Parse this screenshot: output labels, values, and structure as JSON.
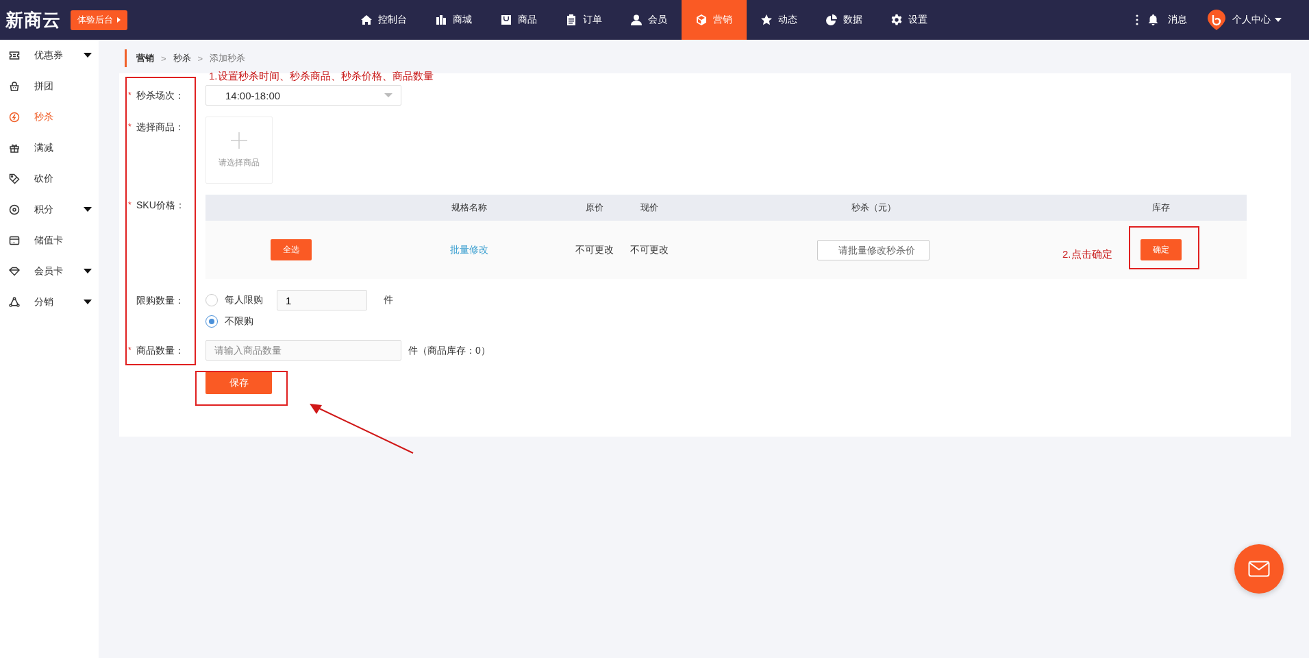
{
  "header": {
    "logo": "新商云",
    "trial_button": "体验后台",
    "nav": [
      {
        "label": "控制台",
        "selected": false
      },
      {
        "label": "商城",
        "selected": false
      },
      {
        "label": "商品",
        "selected": false
      },
      {
        "label": "订单",
        "selected": false
      },
      {
        "label": "会员",
        "selected": false
      },
      {
        "label": "营销",
        "selected": true
      },
      {
        "label": "动态",
        "selected": false
      },
      {
        "label": "数据",
        "selected": false
      },
      {
        "label": "设置",
        "selected": false
      }
    ],
    "messages": "消息",
    "user_menu": "个人中心"
  },
  "sidebar": {
    "items": [
      {
        "label": "优惠券",
        "selected": false,
        "expandable": true
      },
      {
        "label": "拼团",
        "selected": false,
        "expandable": false
      },
      {
        "label": "秒杀",
        "selected": true,
        "expandable": false
      },
      {
        "label": "满减",
        "selected": false,
        "expandable": false
      },
      {
        "label": "砍价",
        "selected": false,
        "expandable": false
      },
      {
        "label": "积分",
        "selected": false,
        "expandable": true
      },
      {
        "label": "储值卡",
        "selected": false,
        "expandable": false
      },
      {
        "label": "会员卡",
        "selected": false,
        "expandable": true
      },
      {
        "label": "分销",
        "selected": false,
        "expandable": true
      }
    ]
  },
  "breadcrumb": {
    "items": [
      "营销",
      "秒杀",
      "添加秒杀"
    ],
    "separators": [
      ">",
      ">"
    ]
  },
  "form": {
    "session": {
      "label": "秒杀场次：",
      "required_mark": "*",
      "value": "14:00-18:00"
    },
    "goods": {
      "label": "选择商品：",
      "required_mark": "*",
      "picker_text": "请选择商品"
    },
    "sku": {
      "label": "SKU价格：",
      "required_mark": "*",
      "columns": [
        "规格名称",
        "原价",
        "现价",
        "秒杀（元）",
        "库存"
      ],
      "batch_row": {
        "select_all": "全选",
        "batch_edit": "批量修改",
        "original": "不可更改",
        "current": "不可更改",
        "price_placeholder": "请批量修改秒杀价",
        "confirm": "确定"
      }
    },
    "limit": {
      "label": "限购数量：",
      "options": [
        {
          "label": "每人限购",
          "selected": false
        },
        {
          "label": "不限购",
          "selected": true
        }
      ],
      "per_person_value": "1",
      "unit": "件"
    },
    "quantity": {
      "label": "商品数量：",
      "required_mark": "*",
      "placeholder": "请输入商品数量",
      "suffix": "件（商品库存：0）"
    },
    "save": "保存"
  },
  "annotations": [
    {
      "kind": "frame"
    },
    {
      "kind": "frame"
    },
    {
      "kind": "frame"
    },
    {
      "kind": "note",
      "text": "1.设置秒杀时间、秒杀商品、秒杀价格、商品数量"
    },
    {
      "kind": "note",
      "text": "2.点击确定"
    },
    {
      "kind": "arrow"
    }
  ]
}
